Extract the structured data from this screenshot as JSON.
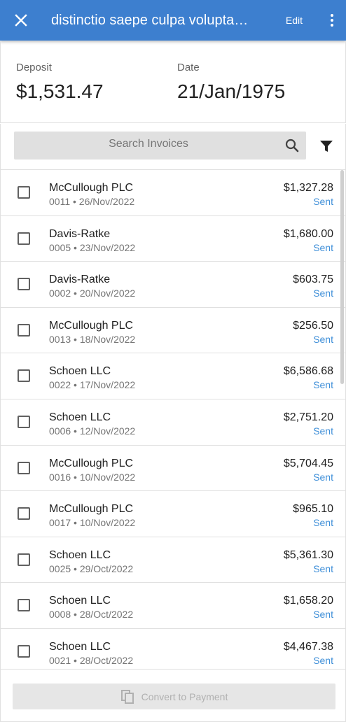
{
  "appbar": {
    "title": "distinctio saepe culpa volupta…",
    "edit_label": "Edit",
    "close_icon": "close-icon",
    "more_icon": "more-vert-icon"
  },
  "summary": {
    "deposit_label": "Deposit",
    "deposit_value": "$1,531.47",
    "date_label": "Date",
    "date_value": "21/Jan/1975"
  },
  "search": {
    "placeholder": "Search Invoices",
    "search_icon": "search-icon",
    "filter_icon": "filter-icon"
  },
  "invoices": [
    {
      "client": "McCullough PLC",
      "sub": "0011 • 26/Nov/2022",
      "amount": "$1,327.28",
      "status": "Sent"
    },
    {
      "client": "Davis-Ratke",
      "sub": "0005 • 23/Nov/2022",
      "amount": "$1,680.00",
      "status": "Sent"
    },
    {
      "client": "Davis-Ratke",
      "sub": "0002 • 20/Nov/2022",
      "amount": "$603.75",
      "status": "Sent"
    },
    {
      "client": "McCullough PLC",
      "sub": "0013 • 18/Nov/2022",
      "amount": "$256.50",
      "status": "Sent"
    },
    {
      "client": "Schoen LLC",
      "sub": "0022 • 17/Nov/2022",
      "amount": "$6,586.68",
      "status": "Sent"
    },
    {
      "client": "Schoen LLC",
      "sub": "0006 • 12/Nov/2022",
      "amount": "$2,751.20",
      "status": "Sent"
    },
    {
      "client": "McCullough PLC",
      "sub": "0016 • 10/Nov/2022",
      "amount": "$5,704.45",
      "status": "Sent"
    },
    {
      "client": "McCullough PLC",
      "sub": "0017 • 10/Nov/2022",
      "amount": "$965.10",
      "status": "Sent"
    },
    {
      "client": "Schoen LLC",
      "sub": "0025 • 29/Oct/2022",
      "amount": "$5,361.30",
      "status": "Sent"
    },
    {
      "client": "Schoen LLC",
      "sub": "0008 • 28/Oct/2022",
      "amount": "$1,658.20",
      "status": "Sent"
    },
    {
      "client": "Schoen LLC",
      "sub": "0021 • 28/Oct/2022",
      "amount": "$4,467.38",
      "status": "Sent"
    }
  ],
  "footer": {
    "convert_label": "Convert to Payment",
    "convert_icon": "copy-icon"
  },
  "colors": {
    "primary": "#3d7fcf",
    "status_sent": "#3d8ed8"
  }
}
